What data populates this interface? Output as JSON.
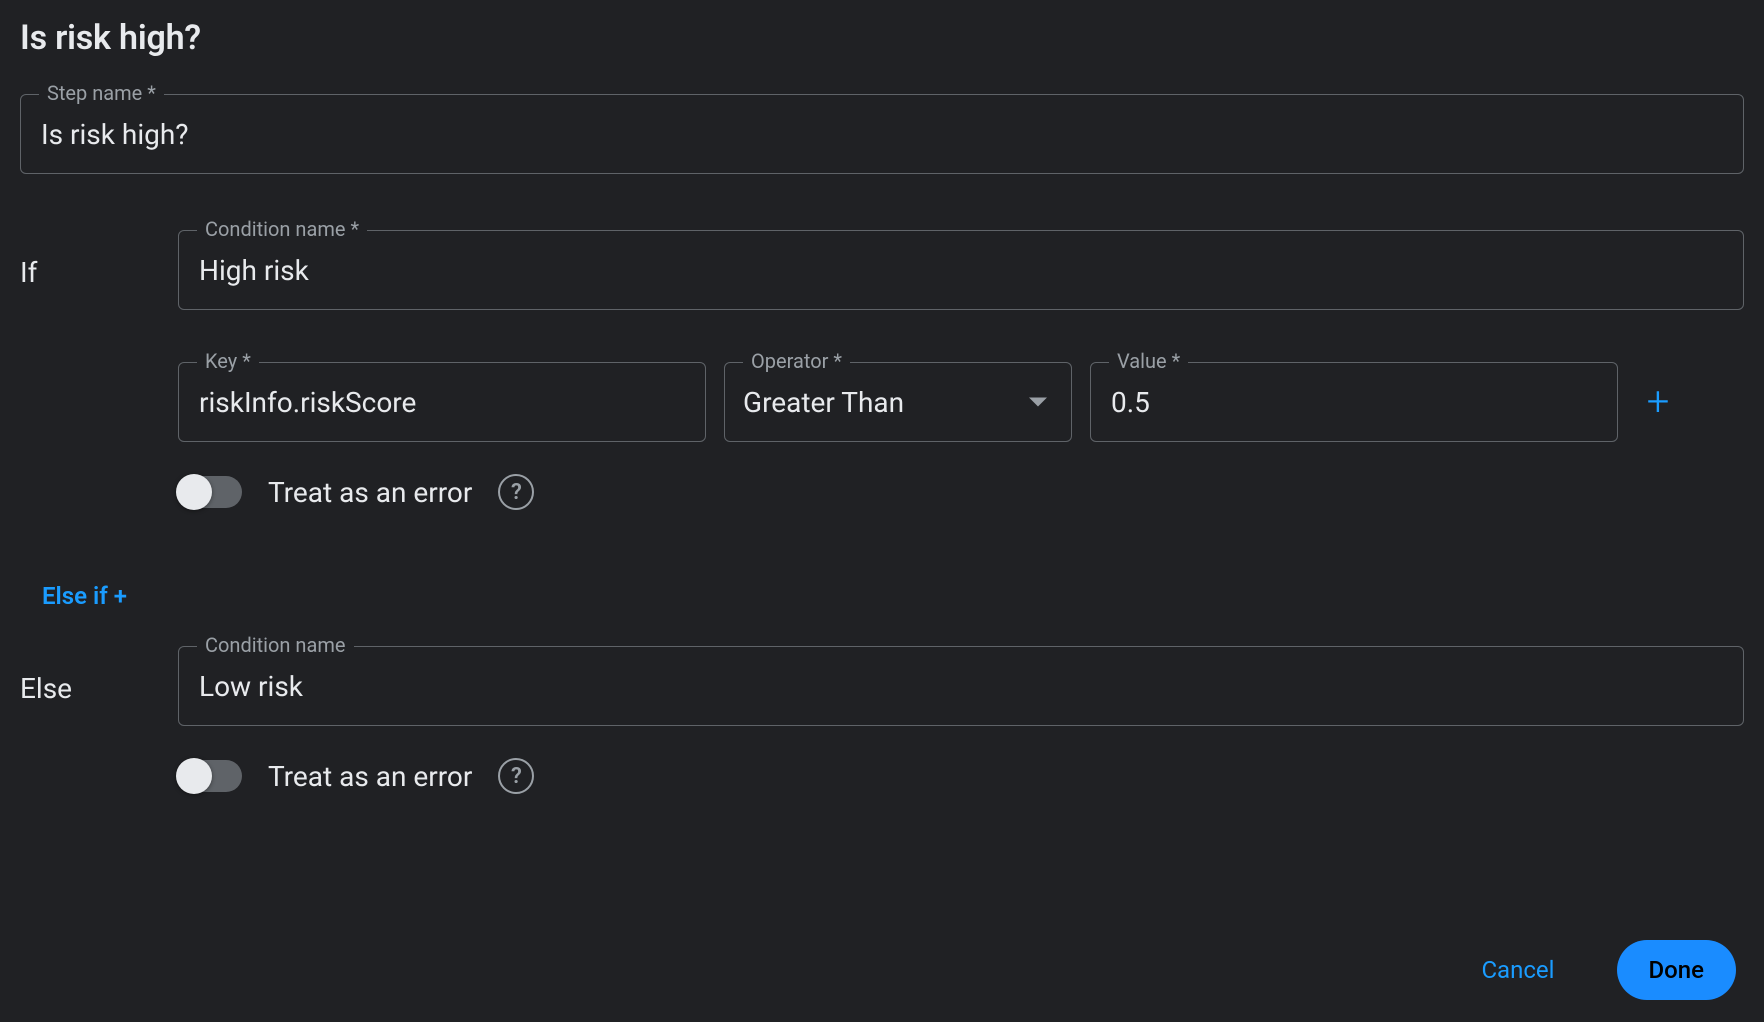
{
  "title": "Is risk high?",
  "stepName": {
    "label": "Step name *",
    "value": "Is risk high?"
  },
  "if": {
    "label": "If",
    "conditionName": {
      "label": "Condition name *",
      "value": "High risk"
    },
    "key": {
      "label": "Key *",
      "value": "riskInfo.riskScore"
    },
    "operator": {
      "label": "Operator *",
      "value": "Greater Than"
    },
    "value": {
      "label": "Value *",
      "value": "0.5"
    },
    "treatError": {
      "label": "Treat as an error",
      "checked": false
    }
  },
  "elseIf": {
    "label": "Else if +"
  },
  "else": {
    "label": "Else",
    "conditionName": {
      "label": "Condition name",
      "value": "Low risk"
    },
    "treatError": {
      "label": "Treat as an error",
      "checked": false
    }
  },
  "buttons": {
    "cancel": "Cancel",
    "done": "Done"
  }
}
